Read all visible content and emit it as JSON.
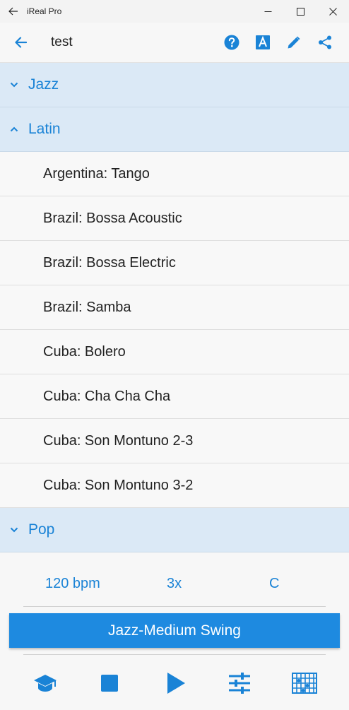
{
  "window": {
    "title": "iReal Pro"
  },
  "appbar": {
    "title": "test"
  },
  "categories_top": [
    {
      "label": "Jazz",
      "expanded": false
    },
    {
      "label": "Latin",
      "expanded": true
    }
  ],
  "latin_items": [
    "Argentina: Tango",
    "Brazil: Bossa Acoustic",
    "Brazil: Bossa Electric",
    "Brazil: Samba",
    "Cuba: Bolero",
    "Cuba: Cha Cha Cha",
    "Cuba: Son Montuno 2-3",
    "Cuba: Son Montuno 3-2"
  ],
  "categories_bottom": [
    {
      "label": "Pop",
      "expanded": false
    }
  ],
  "player": {
    "tempo": "120 bpm",
    "repeats": "3x",
    "key": "C",
    "style": "Jazz-Medium Swing"
  },
  "colors": {
    "accent": "#1a83d6",
    "category_bg": "#dbe9f6",
    "style_button": "#1e8ae0"
  },
  "icons": [
    "back-arrow-icon",
    "help-icon",
    "font-icon",
    "pencil-icon",
    "share-icon",
    "graduation-cap-icon",
    "stop-icon",
    "play-icon",
    "mixer-icon",
    "keyboard-grid-icon"
  ]
}
